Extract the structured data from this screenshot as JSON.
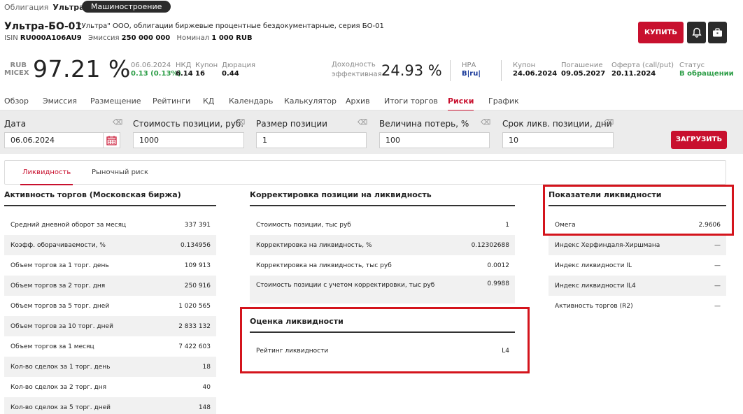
{
  "breadcrumb": {
    "type": "Облигация",
    "issuer": "Ультра",
    "sector": "Машиностроение"
  },
  "header": {
    "title": "Ультра-БО-01",
    "subtitle": "\"Ультра\" ООО, облигации биржевые процентные бездокументарные, серия БО-01",
    "isin_label": "ISIN",
    "isin": "RU000A106AU9",
    "emission_label": "Эмиссия",
    "emission": "250 000 000",
    "nominal_label": "Номинал",
    "nominal": "1 000 RUB",
    "buy_label": "КУПИТЬ"
  },
  "quote": {
    "currency": "RUB",
    "exchange": "MICEX",
    "price": "97.21 %",
    "date": "06.06.2024",
    "change": "0.13 (0.13%)",
    "nkd_label": "НКД",
    "nkd": "6.14",
    "coupon_label": "Купон",
    "coupon": "16",
    "duration_label": "Дюрация",
    "duration": "0.44",
    "yield_label1": "Доходность",
    "yield_label2": "эффективная",
    "yield": "24.93 %",
    "nra_label": "НРА",
    "nra": "B|ru|",
    "next_coupon_label": "Купон",
    "next_coupon": "24.06.2024",
    "maturity_label": "Погашение",
    "maturity": "09.05.2027",
    "offer_label": "Оферта (call/put)",
    "offer": "20.11.2024",
    "status_label": "Статус",
    "status": "В обращении"
  },
  "tabs": [
    "Обзор",
    "Эмиссия",
    "Размещение",
    "Рейтинги",
    "КД",
    "Календарь",
    "Калькулятор",
    "Архив",
    "Итоги торгов",
    "Риски",
    "График"
  ],
  "filters": {
    "date_label": "Дата",
    "date": "06.06.2024",
    "cost_label": "Стоимость позиции, руб.",
    "cost": "1000",
    "size_label": "Размер позиции",
    "size": "1",
    "loss_label": "Величина потерь, %",
    "loss": "100",
    "term_label": "Срок ликв. позиции, дни",
    "term": "10",
    "load_label": "ЗАГРУЗИТЬ"
  },
  "subtabs": [
    "Ликвидность",
    "Рыночный риск"
  ],
  "activity": {
    "title": "Активность торгов (Московская биржа)",
    "rows": [
      {
        "label": "Средний дневной оборот за месяц",
        "value": "337 391"
      },
      {
        "label": "Коэфф. оборачиваемости, %",
        "value": "0.134956"
      },
      {
        "label": "Объем торгов за 1 торг. день",
        "value": "109 913"
      },
      {
        "label": "Объем торгов за 2 торг. дня",
        "value": "250 916"
      },
      {
        "label": "Объем торгов за 5 торг. дней",
        "value": "1 020 565"
      },
      {
        "label": "Объем торгов за 10 торг. дней",
        "value": "2 833 132"
      },
      {
        "label": "Объем торгов за 1 месяц",
        "value": "7 422 603"
      },
      {
        "label": "Кол-во сделок за 1 торг. день",
        "value": "18"
      },
      {
        "label": "Кол-во сделок за 2 торг. дня",
        "value": "40"
      },
      {
        "label": "Кол-во сделок за 5 торг. дней",
        "value": "148"
      }
    ]
  },
  "adjust": {
    "title": "Корректировка позиции на ликвидность",
    "rows": [
      {
        "label": "Стоимость позиции, тыс руб",
        "value": "1"
      },
      {
        "label": "Корректировка на ликвидность, %",
        "value": "0.12302688"
      },
      {
        "label": "Корректировка на ликвидность, тыс руб",
        "value": "0.0012"
      },
      {
        "label": "Стоимость позиции с учетом корректировки, тыс руб",
        "value": "0.9988"
      }
    ]
  },
  "rating": {
    "title": "Оценка ликвидности",
    "label": "Рейтинг ликвидности",
    "value": "L4"
  },
  "indicators": {
    "title": "Показатели ликвидности",
    "rows": [
      {
        "label": "Омега",
        "value": "2.9606"
      },
      {
        "label": "Индекс Херфиндаля-Хиршмана",
        "value": "—"
      },
      {
        "label": "Индекс ликвидности IL",
        "value": "—"
      },
      {
        "label": "Индекс ликвидности IL4",
        "value": "—"
      },
      {
        "label": "Активность торгов (R2)",
        "value": "—"
      }
    ]
  }
}
